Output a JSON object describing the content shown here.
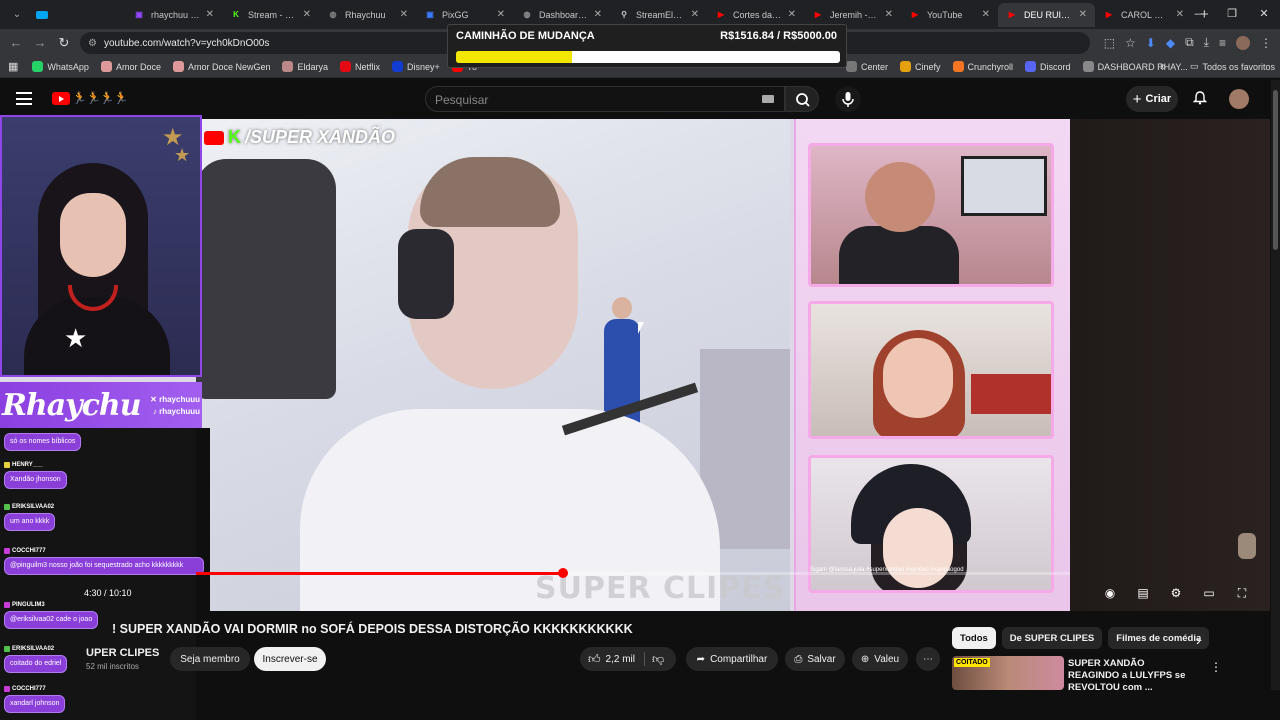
{
  "browser": {
    "tabs": [
      {
        "label": "rhaychuu - Tw",
        "color": "#9146ff",
        "glyph": "▣"
      },
      {
        "label": "Stream - Kick",
        "color": "#53fc18",
        "glyph": "K"
      },
      {
        "label": "Rhaychuu",
        "color": "#888888",
        "glyph": "◍"
      },
      {
        "label": "PixGG",
        "color": "#3a7bff",
        "glyph": "▣"
      },
      {
        "label": "Dashboard - I",
        "color": "#999999",
        "glyph": "◍"
      },
      {
        "label": "StreamElemen",
        "color": "#cccccc",
        "glyph": "⚲"
      },
      {
        "label": "Cortes da Rha",
        "color": "#ff0000",
        "glyph": "▶"
      },
      {
        "label": "Jeremih - Dow",
        "color": "#ff0000",
        "glyph": "▶"
      },
      {
        "label": "YouTube",
        "color": "#ff0000",
        "glyph": "▶"
      },
      {
        "label": "DEU RUIM! S",
        "color": "#ff0000",
        "glyph": "▶"
      },
      {
        "label": "CAROL REAGI",
        "color": "#ff0000",
        "glyph": "▶"
      }
    ],
    "url": "youtube.com/watch?v=ych0kDnO00s",
    "bookmarks": [
      {
        "label": "WhatsApp",
        "color": "#25d366"
      },
      {
        "label": "Amor Doce",
        "color": "#d99"
      },
      {
        "label": "Amor Doce NewGen",
        "color": "#d99"
      },
      {
        "label": "Eldarya",
        "color": "#b88"
      },
      {
        "label": "Netflix",
        "color": "#e50914"
      },
      {
        "label": "Disney+",
        "color": "#113ccf"
      },
      {
        "label": "Yo",
        "color": "#ff0000"
      }
    ],
    "bookmarks_right": [
      {
        "label": "Center",
        "color": "#777"
      },
      {
        "label": "Cinefy",
        "color": "#e5a00d"
      },
      {
        "label": "Crunchyroll",
        "color": "#f47521"
      },
      {
        "label": "Discord",
        "color": "#5865f2"
      },
      {
        "label": "DASHBOARD RHAY...",
        "color": "#888"
      }
    ],
    "all_bookmarks": "Todos os favoritos"
  },
  "goal": {
    "title": "CAMINHÃO DE MUDANÇA",
    "amount": "R$1516.84 / R$5000.00",
    "progress": 0.303
  },
  "youtube": {
    "search_placeholder": "Pesquisar",
    "create_label": "Criar"
  },
  "streamer": {
    "name": "Rhaychu",
    "handle1": "✕ rhaychuuu",
    "handle2": "♪ rhaychuuu"
  },
  "video": {
    "watermark": "/SUPER XANDÃO",
    "overlay_text": "SUPER CLIPES",
    "time": "4:30 / 10:10",
    "progress": 0.42,
    "title": "! SUPER XANDÃO VAI DORMIR no SOFÁ DEPOIS DESSA DISTORÇÃO KKKKKKKKKKK",
    "channel": "UPER CLIPES",
    "subscribers": "52 mil inscritos",
    "member_label": "Seja membro",
    "subscribe_label": "Inscrever-se",
    "likes": "2,2 mil",
    "share_label": "Compartilhar",
    "save_label": "Salvar",
    "thanks_label": "Valeu"
  },
  "chat": [
    {
      "user": "",
      "text": "só os nomes bíblicos",
      "badge": "#8a3fd9"
    },
    {
      "user": "HENRY___",
      "text": "Xandão jhonson",
      "badge": "#e6d040"
    },
    {
      "user": "ERIKSILVAA02",
      "text": "um ano kkkk",
      "badge": "#53c24c"
    },
    {
      "user": "COCCHI777",
      "text": "@pinguilm3 nosso joão foi sequestrado acho kkkkkkkkk",
      "badge": "#c73cd6"
    },
    {
      "user": "PINGULIM3",
      "text": "@eriksilvaa02 cade o joao",
      "badge": "#c73cd6"
    },
    {
      "user": "ERIKSILVAA02",
      "text": "coitado do edriel",
      "badge": "#53c24c"
    },
    {
      "user": "COCCHI777",
      "text": "xandarl johnson",
      "badge": "#c73cd6"
    }
  ],
  "recommendations": {
    "chips": [
      "Todos",
      "De SUPER CLIPES",
      "Filmes de comédia"
    ],
    "item_title": "SUPER XANDÃO REAGINDO a LULYFPS se REVOLTOU com ...",
    "item_badge": "COITADO"
  },
  "cam_caption": "Sigam @larissa.julia #superxandao #xandao #xandaogod"
}
